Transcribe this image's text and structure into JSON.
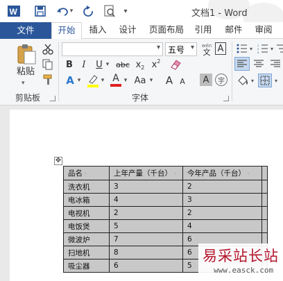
{
  "window": {
    "title": "文档1 - Word",
    "app_icon": "word-icon"
  },
  "quick_access": {
    "save": "save-icon",
    "undo": "undo-icon",
    "redo": "redo-icon",
    "preview": "print-preview-icon",
    "customize": "▾"
  },
  "tabs": [
    {
      "label": "文件"
    },
    {
      "label": "开始"
    },
    {
      "label": "插入"
    },
    {
      "label": "设计"
    },
    {
      "label": "页面布局"
    },
    {
      "label": "引用"
    },
    {
      "label": "邮件"
    },
    {
      "label": "审阅"
    }
  ],
  "clipboard": {
    "paste_label": "粘贴",
    "group_label": "剪贴板"
  },
  "font": {
    "name_value": "",
    "size_value": "五号",
    "grow": "A",
    "shrink": "A",
    "aa_label": "Aa",
    "group_label": "字体",
    "buttons": {
      "bold": "B",
      "italic": "I",
      "underline": "U",
      "strike": "abc",
      "subscript": "x",
      "subscript_sup": "2",
      "superscript": "x",
      "superscript_sup": "2",
      "wen": "wén",
      "wen_char": "文",
      "boxed": "A",
      "char_shade": "A",
      "circle": "字"
    },
    "colors": {
      "highlight": "#ffff00",
      "font_color": "#e02020",
      "brand": "#2b579a"
    }
  },
  "table": {
    "header": [
      "品名",
      "上年产量（千台）",
      "今年产品（千台）"
    ],
    "rows": [
      [
        "洗衣机",
        "3",
        "2"
      ],
      [
        "电冰箱",
        "4",
        "3"
      ],
      [
        "电视机",
        "2",
        "2"
      ],
      [
        "电饭煲",
        "5",
        "4"
      ],
      [
        "微波炉",
        "7",
        "6"
      ],
      [
        "扫地机",
        "8",
        "6"
      ],
      [
        "吸尘器",
        "6",
        "5"
      ]
    ]
  },
  "watermark": {
    "text": "易采站长站",
    "url": "www.easck.com"
  }
}
